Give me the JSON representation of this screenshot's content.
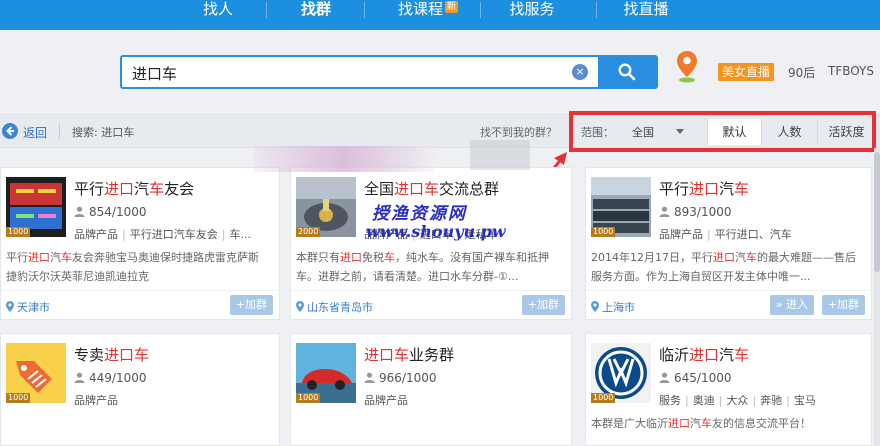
{
  "nav": {
    "items": [
      {
        "label": "找人"
      },
      {
        "label": "找群"
      },
      {
        "label": "找课程",
        "badge": "新"
      },
      {
        "label": "找服务"
      },
      {
        "label": "找直播"
      }
    ]
  },
  "search": {
    "value": "进口车",
    "clear_glyph": "×"
  },
  "hot": {
    "tag": "美女直播",
    "items": [
      "90后",
      "TFBOYS"
    ]
  },
  "toolbar": {
    "back_label": "返回",
    "search_label": "搜索: 进口车",
    "notfound": "找不到我的群？",
    "scope_label": "范围：",
    "scope_value": "全国",
    "sort_tabs": [
      "默认",
      "人数",
      "活跃度"
    ]
  },
  "watermark": {
    "line1": "授渔资源网",
    "line2": "www.shouyu.pw"
  },
  "cards": [
    {
      "title_pre": "平行",
      "title_hl": "进口",
      "title_mid": "汽",
      "title_hl2": "车",
      "title_post": "友会",
      "count": "854/1000",
      "tags": [
        "品牌产品",
        "平行进口汽车友会",
        "车..."
      ],
      "desc_parts": [
        "平行",
        "进口",
        "汽",
        "车",
        "友会奔驰宝马奥迪保时捷路虎雷克萨斯捷豹沃尔沃英菲尼迪凯迪拉克"
      ],
      "location": "天津市",
      "join_label": "+加群",
      "level": "1000"
    },
    {
      "title_pre": "全国",
      "title_hl": "进口",
      "title_mid": "",
      "title_hl2": "车",
      "title_post": "交流总群",
      "count": "",
      "tags": [
        "品牌产品",
        "进口车",
        "走私车"
      ],
      "desc_parts": [
        "本群只有",
        "进口",
        "免税",
        "车",
        "，纯水车。没有国产裸车和抵押车。进群之前，请看清楚。进口水车分群-①..."
      ],
      "location": "山东省青岛市",
      "join_label": "+加群",
      "level": "2000"
    },
    {
      "title_pre": "平行",
      "title_hl": "进口",
      "title_mid": "汽",
      "title_hl2": "车",
      "title_post": "",
      "count": "893/1000",
      "tags": [
        "品牌产品",
        "平行进口、汽车"
      ],
      "desc_parts": [
        "2014年12月17日，平行",
        "进口",
        "汽",
        "车",
        "的最大难题——售后服务方面。作为上海自贸区开发主体中唯一..."
      ],
      "location": "上海市",
      "enter_label": "» 进入",
      "join_label": "+加群",
      "level": "1000"
    },
    {
      "title_pre": "专卖",
      "title_hl": "进口",
      "title_mid": "",
      "title_hl2": "车",
      "title_post": "",
      "count": "449/1000",
      "tags": [
        "品牌产品"
      ],
      "level": "1000"
    },
    {
      "title_pre": "",
      "title_hl": "进口",
      "title_mid": "",
      "title_hl2": "车",
      "title_post": "业务群",
      "count": "966/1000",
      "tags": [
        "品牌产品"
      ],
      "level": "1000"
    },
    {
      "title_pre": "临沂",
      "title_hl": "进口",
      "title_mid": "汽",
      "title_hl2": "车",
      "title_post": "",
      "count": "645/1000",
      "tags": [
        "服务",
        "奥迪",
        "大众",
        "奔驰",
        "宝马"
      ],
      "desc_parts": [
        "本群是广大临沂",
        "进口",
        "汽",
        "车",
        "友的信息交流平台！"
      ],
      "level": "1000"
    }
  ]
}
